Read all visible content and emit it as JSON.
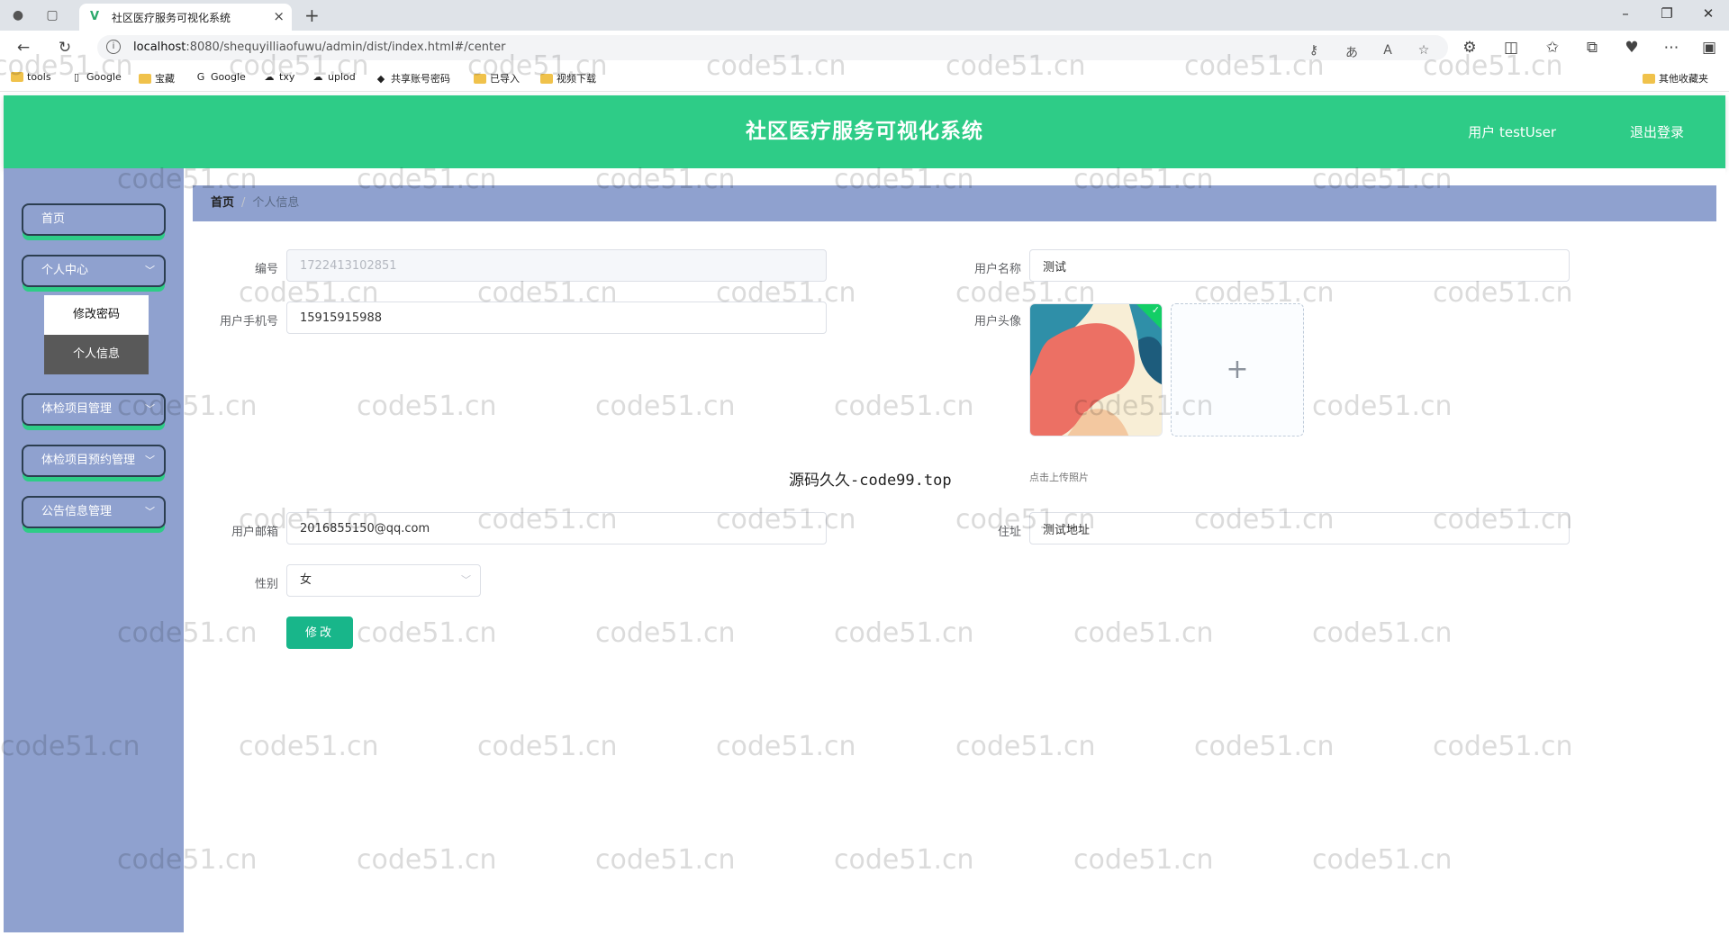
{
  "browser": {
    "tab_title": "社区医疗服务可视化系统",
    "url_host": "localhost",
    "url_path": ":8080/shequyilliaofuwu/admin/dist/index.html#/center",
    "bookmarks": [
      "tools",
      "Google",
      "宝藏",
      "Google",
      "txy",
      "uplod",
      "共享账号密码",
      "已导入",
      "视频下载"
    ],
    "other_bookmarks": "其他收藏夹"
  },
  "header": {
    "title": "社区医疗服务可视化系统",
    "user_label": "用户 testUser",
    "logout": "退出登录"
  },
  "sidebar": {
    "items": [
      {
        "label": "首页"
      },
      {
        "label": "个人中心"
      },
      {
        "label": "体检项目管理"
      },
      {
        "label": "体检项目预约管理"
      },
      {
        "label": "公告信息管理"
      }
    ],
    "submenu": [
      {
        "label": "修改密码"
      },
      {
        "label": "个人信息"
      }
    ],
    "chevron": "﹀"
  },
  "breadcrumb": {
    "home": "首页",
    "sep": "/",
    "current": "个人信息"
  },
  "form": {
    "id_label": "编号",
    "id_value": "1722413102851",
    "username_label": "用户名称",
    "username_value": "测试",
    "phone_label": "用户手机号",
    "phone_value": "15915915988",
    "avatar_label": "用户头像",
    "upload_plus": "+",
    "upload_tip": "点击上传照片",
    "email_label": "用户邮箱",
    "email_value": "2016855150@qq.com",
    "address_label": "住址",
    "address_value": "测试地址",
    "gender_label": "性别",
    "gender_value": "女",
    "submit_label": "修改"
  },
  "promo_text": "源码久久-code99.top",
  "watermark_text": "code51.cn",
  "colors": {
    "header_bg": "#2ecc87",
    "sidebar_bg": "#8fa1cf",
    "button": "#18b68a"
  }
}
